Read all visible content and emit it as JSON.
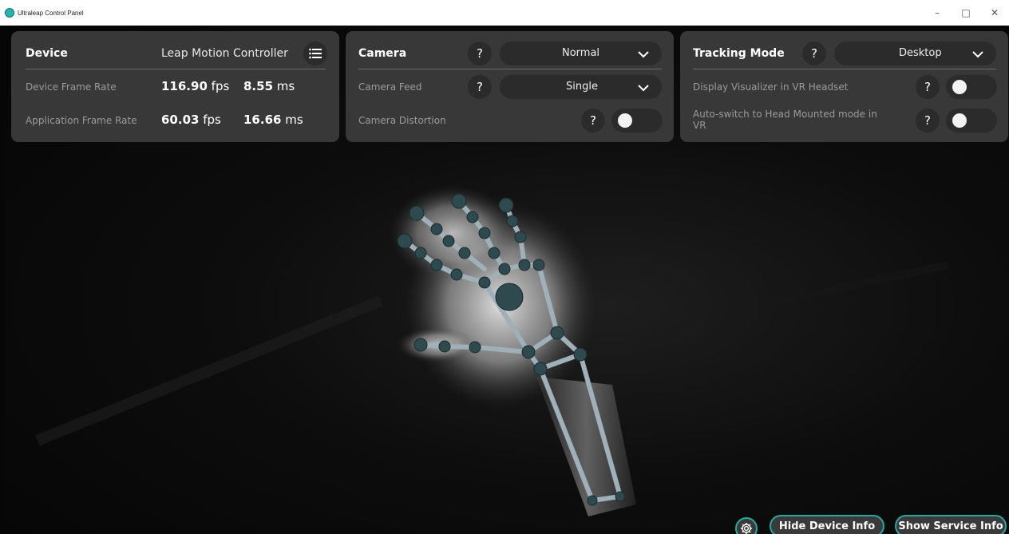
{
  "window": {
    "title": "Ultraleap Control Panel",
    "minimize_glyph": "–",
    "maximize_glyph": "□",
    "close_glyph": "✕"
  },
  "device_panel": {
    "heading": "Device",
    "device_name": "Leap Motion Controller",
    "menu_icon": "list-icon",
    "rows": [
      {
        "label": "Device Frame Rate",
        "fps_value": "116.90",
        "fps_unit": "fps",
        "ms_value": "8.55",
        "ms_unit": "ms"
      },
      {
        "label": "Application Frame Rate",
        "fps_value": "60.03",
        "fps_unit": "fps",
        "ms_value": "16.66",
        "ms_unit": "ms"
      }
    ]
  },
  "camera_panel": {
    "heading": "Camera",
    "help": "?",
    "mode_selected": "Normal",
    "feed_label": "Camera Feed",
    "feed_selected": "Single",
    "distortion_label": "Camera Distortion",
    "distortion_on": false
  },
  "tracking_panel": {
    "heading": "Tracking Mode",
    "help": "?",
    "mode_selected": "Desktop",
    "visualizer_label": "Display Visualizer in VR Headset",
    "visualizer_on": false,
    "autoswitch_label_line1": "Auto-switch to Head Mounted mode in",
    "autoswitch_label_line2": "VR",
    "autoswitch_on": false
  },
  "footer": {
    "settings_icon": "gear-icon",
    "hide_device_info": "Hide Device Info",
    "show_service_info": "Show Service Info"
  },
  "colors": {
    "panel_bg": "#3a3a3a",
    "control_bg": "#2b2b2b",
    "accent": "#2aa7a0",
    "joint": "#2e4a4f"
  }
}
